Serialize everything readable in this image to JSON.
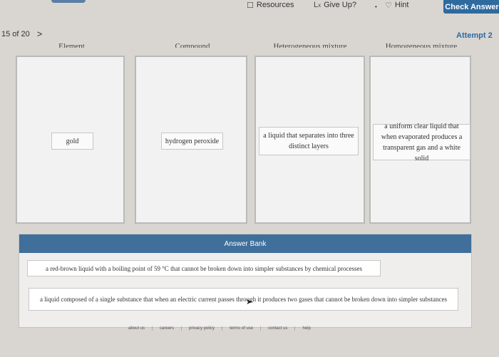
{
  "toolbar": {
    "resources": "Resources",
    "give_up": "Give Up?",
    "hint": "Hint",
    "check_answer": "Check Answer"
  },
  "nav": {
    "question_counter": "15 of 20",
    "next_symbol": ">"
  },
  "attempt": "Attempt 2",
  "columns": [
    {
      "header": "Element",
      "cards": [
        "gold"
      ]
    },
    {
      "header": "Compound",
      "cards": [
        "hydrogen peroxide"
      ]
    },
    {
      "header": "Heterogeneous mixture",
      "cards": [
        "a liquid that separates into three distinct layers"
      ]
    },
    {
      "header": "Homogeneous mixture",
      "cards": [
        "a uniform clear liquid that when evaporated produces a transparent gas and a white solid"
      ]
    }
  ],
  "answer_bank": {
    "title": "Answer Bank",
    "items": [
      "a red-brown liquid with a boiling point of 59 °C that cannot be broken down into simpler substances by chemical processes",
      "a liquid composed of a single substance that when an electric current passes through it produces two gases that cannot be broken down into simpler substances"
    ]
  },
  "footer": [
    "about us",
    "careers",
    "privacy policy",
    "terms of use",
    "contact us",
    "help"
  ]
}
